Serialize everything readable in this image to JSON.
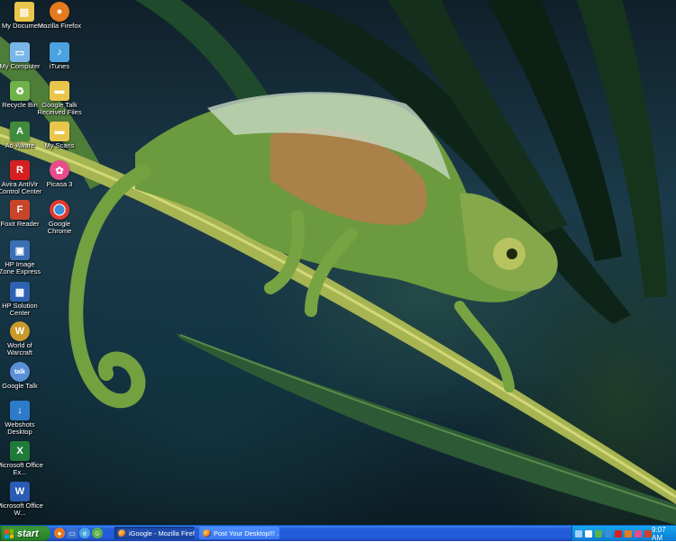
{
  "desktop_icons": [
    {
      "label": "My Documents",
      "icon": "my-documents-icon",
      "color": "#e9c64b"
    },
    {
      "label": "Mozilla Firefox",
      "icon": "firefox-icon",
      "color": "#e67a1e"
    },
    {
      "label": "My Computer",
      "icon": "my-computer-icon",
      "color": "#7ab6e8"
    },
    {
      "label": "iTunes",
      "icon": "itunes-icon",
      "color": "#4aa3e0"
    },
    {
      "label": "Recycle Bin",
      "icon": "recycle-bin-icon",
      "color": "#6fb24a"
    },
    {
      "label": "Google Talk Received Files",
      "icon": "folder-icon",
      "color": "#e9c64b"
    },
    {
      "label": "Ad-Aware",
      "icon": "ad-aware-icon",
      "color": "#3f8a3c"
    },
    {
      "label": "My Scans",
      "icon": "folder-icon",
      "color": "#e9c64b"
    },
    {
      "label": "Avira AntiVir Control Center",
      "icon": "avira-icon",
      "color": "#d42020"
    },
    {
      "label": "Picasa 3",
      "icon": "picasa-icon",
      "color": "#e84c8c"
    },
    {
      "label": "Foxit Reader",
      "icon": "foxit-reader-icon",
      "color": "#c8452b"
    },
    {
      "label": "Google Chrome",
      "icon": "chrome-icon",
      "color": "#3a8fd6"
    },
    {
      "label": "HP Image Zone Express",
      "icon": "hp-image-zone-icon",
      "color": "#3b6fb5"
    },
    {
      "label": "HP Solution Center",
      "icon": "hp-solution-center-icon",
      "color": "#2d62b0"
    },
    {
      "label": "World of Warcraft",
      "icon": "world-of-warcraft-icon",
      "color": "#c99a2a"
    },
    {
      "label": "Google Talk",
      "icon": "google-talk-icon",
      "color": "#5b8fd8"
    },
    {
      "label": "Webshots Desktop",
      "icon": "webshots-icon",
      "color": "#2c7bc8"
    },
    {
      "label": "Microsoft Office Ex...",
      "icon": "excel-icon",
      "color": "#1f7a3a"
    },
    {
      "label": "Microsoft Office W...",
      "icon": "word-icon",
      "color": "#2a5bb5"
    }
  ],
  "taskbar": {
    "start_label": "start",
    "quick_launch": [
      {
        "icon": "firefox-quicklaunch-icon",
        "color": "#e67a1e"
      },
      {
        "icon": "show-desktop-icon",
        "color": "#3a6fd0"
      },
      {
        "icon": "ie-icon",
        "color": "#4aa3e0"
      },
      {
        "icon": "messenger-icon",
        "color": "#5bb04a"
      }
    ],
    "tasks": [
      {
        "label": "iGoogle - Mozilla Firefox",
        "active": true
      },
      {
        "label": "Post Your Desktop!!! ...",
        "active": false
      }
    ],
    "clock": "9:07 AM"
  }
}
